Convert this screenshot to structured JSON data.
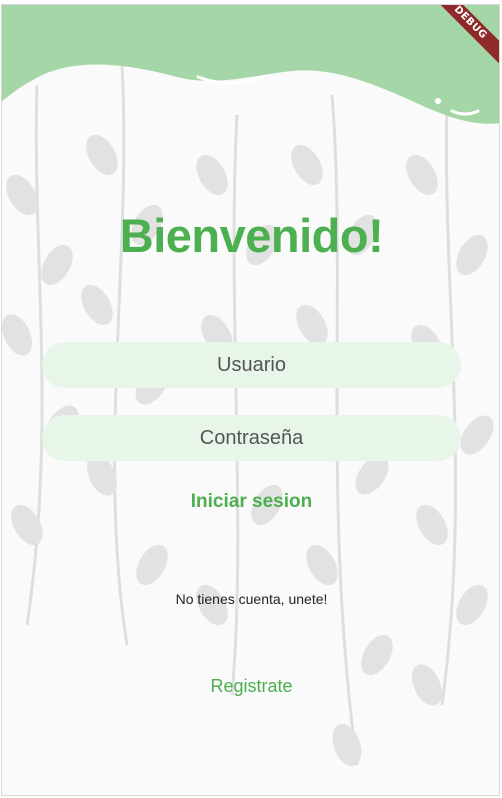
{
  "debug_banner": "DEBUG",
  "title": "Bienvenido!",
  "username": {
    "placeholder": "Usuario",
    "value": ""
  },
  "password": {
    "placeholder": "Contraseña",
    "value": ""
  },
  "login_label": "Iniciar sesion",
  "signup_prompt": "No tienes cuenta, unete!",
  "register_label": "Registrate",
  "colors": {
    "accent": "#4caf50",
    "wave": "#a5d6a7",
    "field_bg": "#e8f5e9",
    "leaf": "#e0e0e0",
    "debug": "#8e2a2a"
  }
}
